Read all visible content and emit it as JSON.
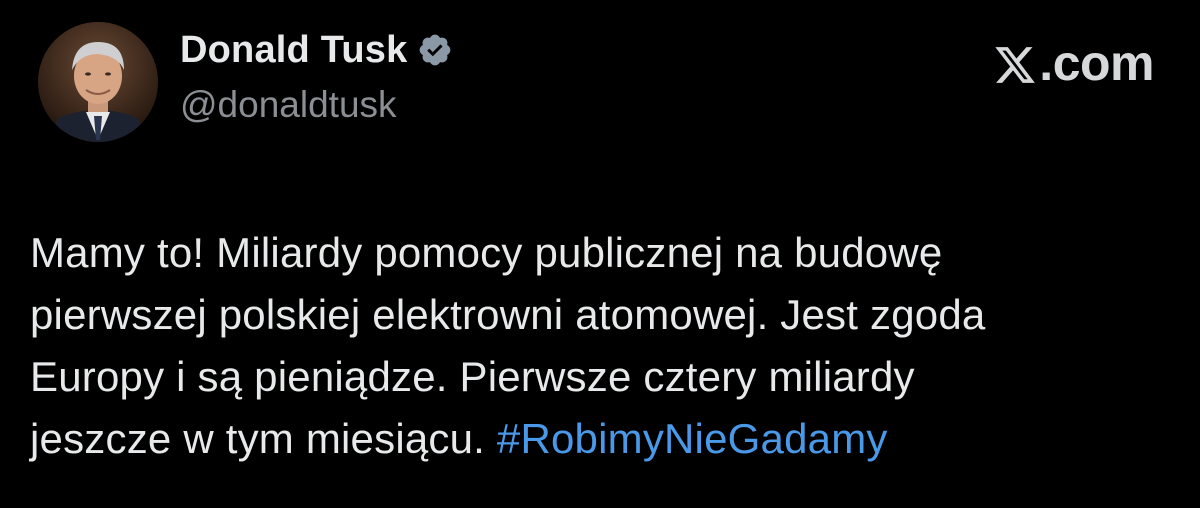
{
  "author": {
    "display_name": "Donald Tusk",
    "handle": "@donaldtusk",
    "verified": true,
    "verified_badge_color": "#8b98a5"
  },
  "brand": {
    "icon": "x-logo-icon",
    "label": ".com"
  },
  "tweet": {
    "text": "Mamy to! Miliardy pomocy publicznej na budowę\npierwszej polskiej elektrowni atomowej. Jest zgoda\nEuropy i są pieniądze. Pierwsze cztery miliardy\njeszcze w tym miesiącu. ",
    "hashtag": "#RobimyNieGadamy",
    "hashtag_color": "#4a99e9"
  },
  "colors": {
    "background": "#000000",
    "text": "#e7e9ea",
    "secondary_text": "#8b8f94"
  }
}
